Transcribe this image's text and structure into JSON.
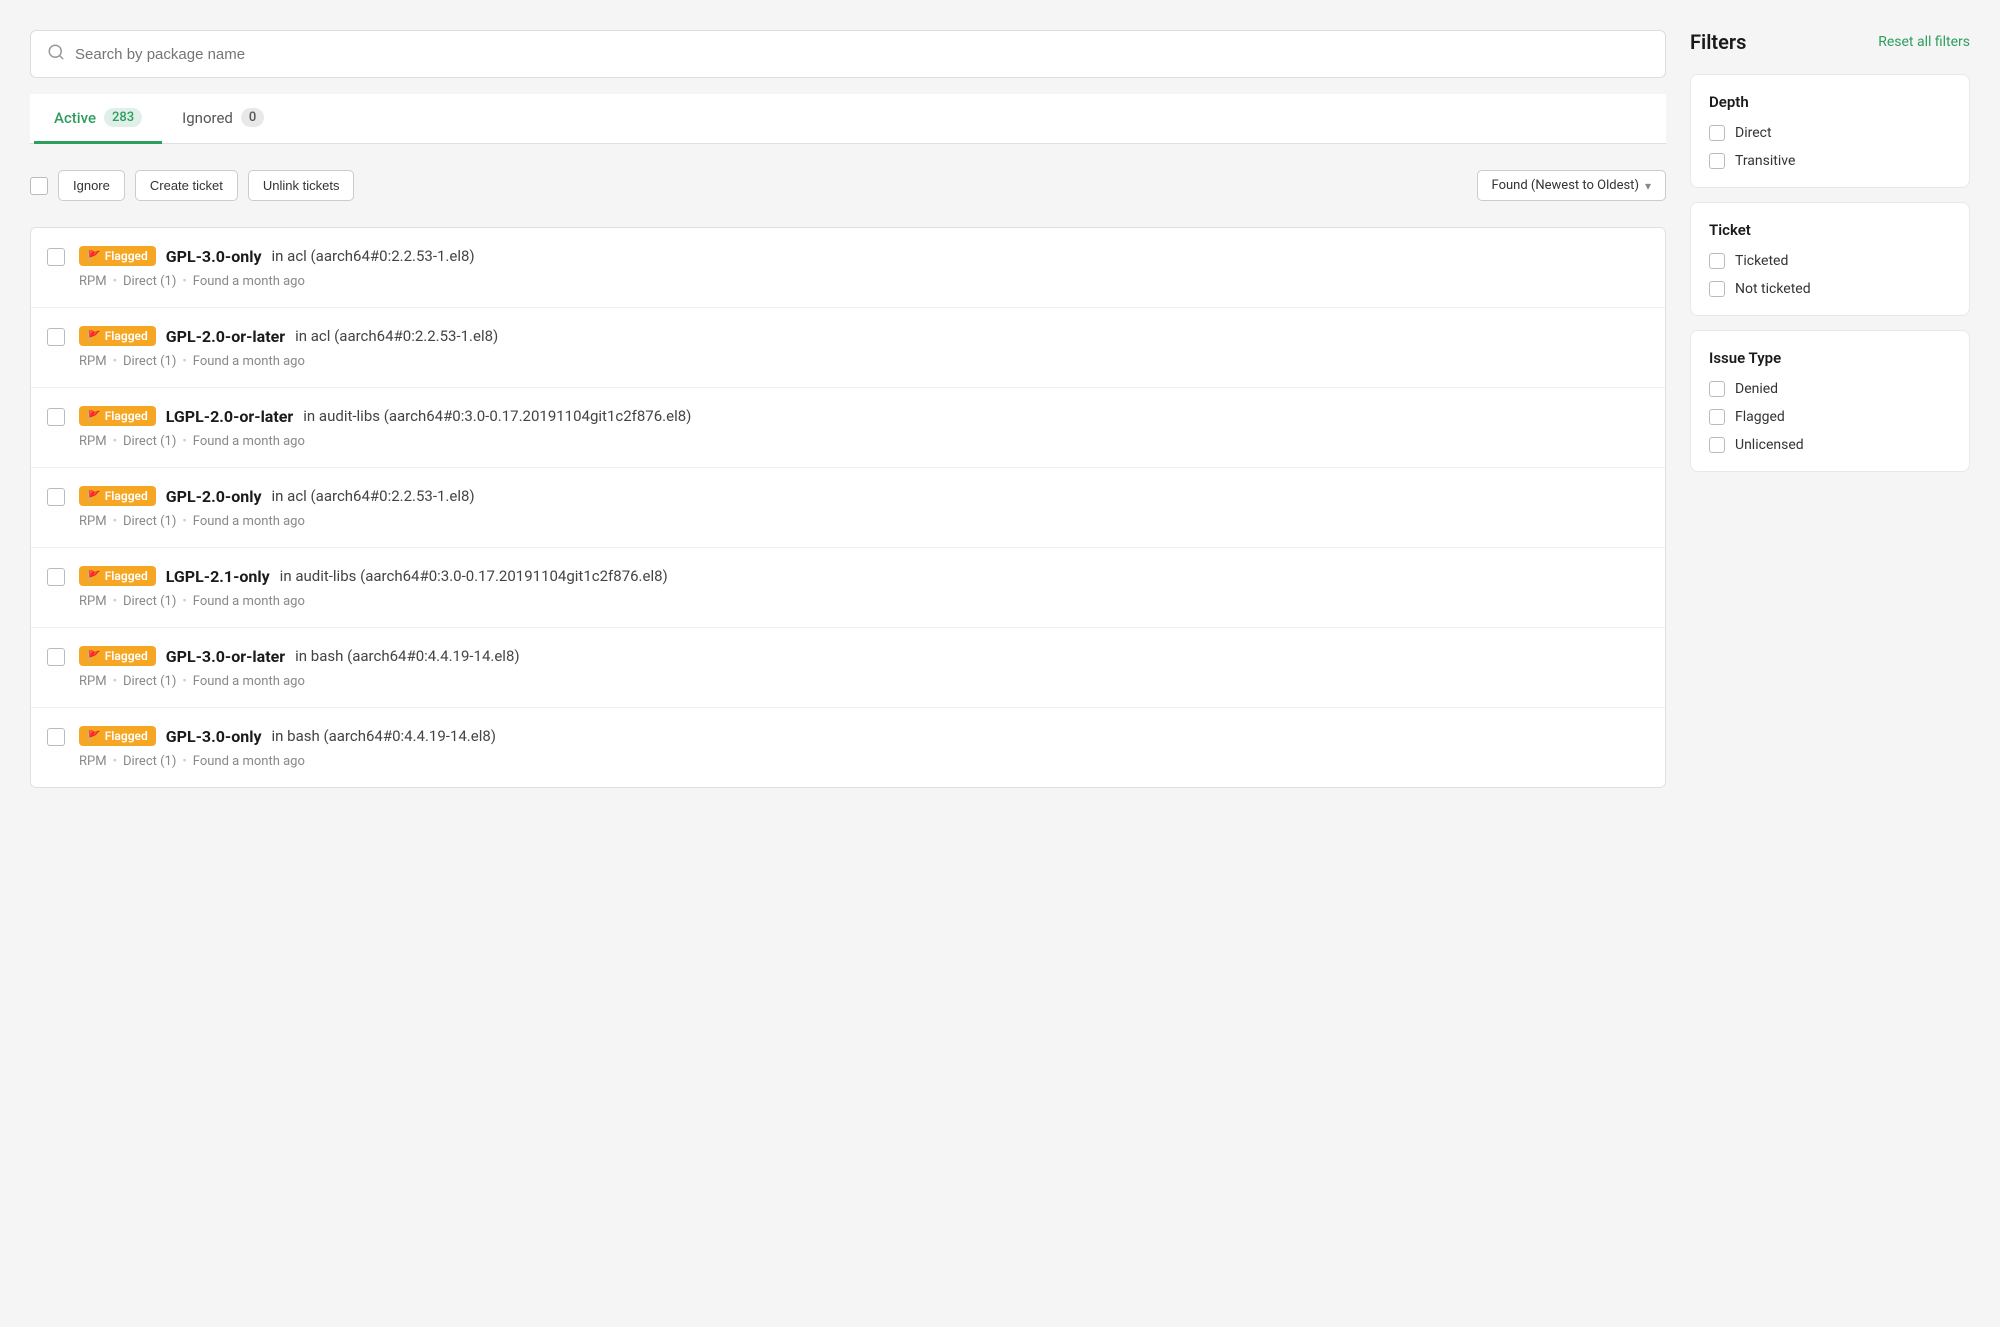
{
  "search": {
    "placeholder": "Search by package name"
  },
  "tabs": [
    {
      "id": "active",
      "label": "Active",
      "count": "283",
      "active": true
    },
    {
      "id": "ignored",
      "label": "Ignored",
      "count": "0",
      "active": false
    }
  ],
  "toolbar": {
    "ignore_label": "Ignore",
    "create_ticket_label": "Create ticket",
    "unlink_tickets_label": "Unlink tickets",
    "sort_label": "Found (Newest to Oldest)"
  },
  "issues": [
    {
      "id": 1,
      "badge": "Flagged",
      "license": "GPL-3.0-only",
      "context": "in acl (aarch64#0:2.2.53-1.el8)",
      "type": "RPM",
      "depth": "Direct (1)",
      "found": "Found a month ago"
    },
    {
      "id": 2,
      "badge": "Flagged",
      "license": "GPL-2.0-or-later",
      "context": "in acl (aarch64#0:2.2.53-1.el8)",
      "type": "RPM",
      "depth": "Direct (1)",
      "found": "Found a month ago"
    },
    {
      "id": 3,
      "badge": "Flagged",
      "license": "LGPL-2.0-or-later",
      "context": "in audit-libs (aarch64#0:3.0-0.17.20191104git1c2f876.el8)",
      "type": "RPM",
      "depth": "Direct (1)",
      "found": "Found a month ago"
    },
    {
      "id": 4,
      "badge": "Flagged",
      "license": "GPL-2.0-only",
      "context": "in acl (aarch64#0:2.2.53-1.el8)",
      "type": "RPM",
      "depth": "Direct (1)",
      "found": "Found a month ago"
    },
    {
      "id": 5,
      "badge": "Flagged",
      "license": "LGPL-2.1-only",
      "context": "in audit-libs (aarch64#0:3.0-0.17.20191104git1c2f876.el8)",
      "type": "RPM",
      "depth": "Direct (1)",
      "found": "Found a month ago"
    },
    {
      "id": 6,
      "badge": "Flagged",
      "license": "GPL-3.0-or-later",
      "context": "in bash (aarch64#0:4.4.19-14.el8)",
      "type": "RPM",
      "depth": "Direct (1)",
      "found": "Found a month ago"
    },
    {
      "id": 7,
      "badge": "Flagged",
      "license": "GPL-3.0-only",
      "context": "in bash (aarch64#0:4.4.19-14.el8)",
      "type": "RPM",
      "depth": "Direct (1)",
      "found": "Found a month ago"
    }
  ],
  "filters": {
    "title": "Filters",
    "reset_label": "Reset all filters",
    "depth": {
      "title": "Depth",
      "options": [
        {
          "id": "direct",
          "label": "Direct"
        },
        {
          "id": "transitive",
          "label": "Transitive"
        }
      ]
    },
    "ticket": {
      "title": "Ticket",
      "options": [
        {
          "id": "ticketed",
          "label": "Ticketed"
        },
        {
          "id": "not-ticketed",
          "label": "Not ticketed"
        }
      ]
    },
    "issue_type": {
      "title": "Issue Type",
      "options": [
        {
          "id": "denied",
          "label": "Denied"
        },
        {
          "id": "flagged",
          "label": "Flagged"
        },
        {
          "id": "unlicensed",
          "label": "Unlicensed"
        }
      ]
    }
  }
}
